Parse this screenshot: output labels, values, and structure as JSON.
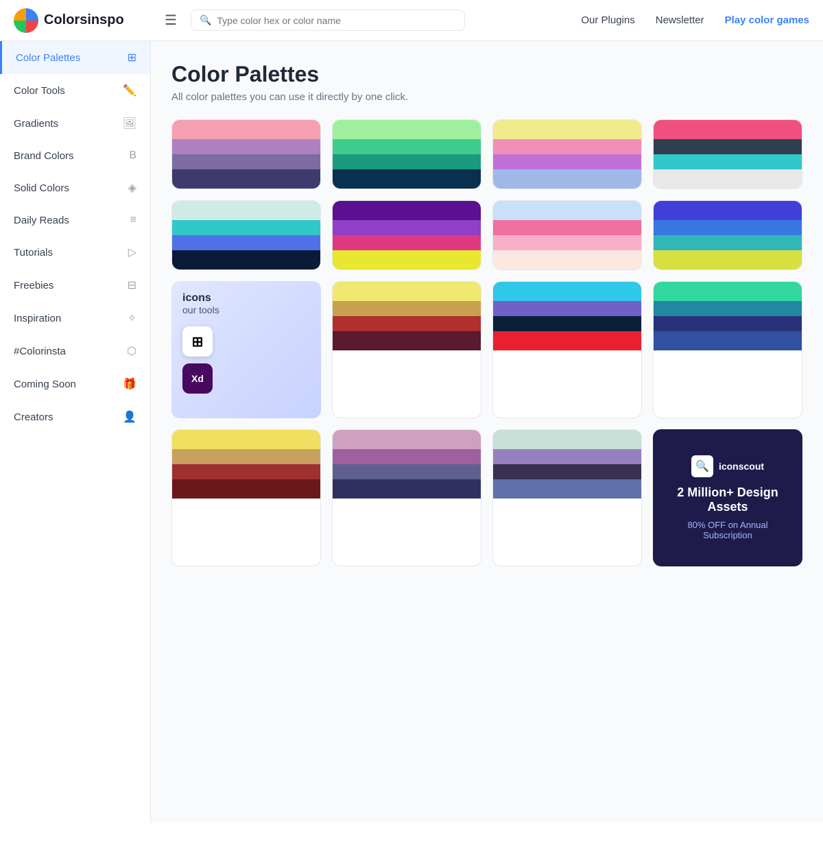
{
  "header": {
    "logo_text": "Colorsinspo",
    "search_placeholder": "Type color hex or color name",
    "nav_plugins": "Our Plugins",
    "nav_newsletter": "Newsletter",
    "nav_play": "Play color games"
  },
  "sidebar": {
    "items": [
      {
        "id": "color-palettes",
        "label": "Color Palettes",
        "icon": "⊞",
        "active": true
      },
      {
        "id": "color-tools",
        "label": "Color Tools",
        "icon": "✏️",
        "active": false
      },
      {
        "id": "gradients",
        "label": "Gradients",
        "icon": "🖼",
        "active": false
      },
      {
        "id": "brand-colors",
        "label": "Brand Colors",
        "icon": "B",
        "active": false
      },
      {
        "id": "solid-colors",
        "label": "Solid Colors",
        "icon": "◈",
        "active": false
      },
      {
        "id": "daily-reads",
        "label": "Daily Reads",
        "icon": "≡",
        "active": false
      },
      {
        "id": "tutorials",
        "label": "Tutorials",
        "icon": "▷",
        "active": false
      },
      {
        "id": "freebies",
        "label": "Freebies",
        "icon": "⊟",
        "active": false
      },
      {
        "id": "inspiration",
        "label": "Inspiration",
        "icon": "✧",
        "active": false
      },
      {
        "id": "colorinsta",
        "label": "#Colorinsta",
        "icon": "⬡",
        "active": false
      },
      {
        "id": "coming-soon",
        "label": "Coming Soon",
        "icon": "🎁",
        "active": false
      },
      {
        "id": "creators",
        "label": "Creators",
        "icon": "👤",
        "active": false
      }
    ]
  },
  "main": {
    "title": "Color Palettes",
    "subtitle": "All color palettes you can use it directly by one click.",
    "palettes": [
      {
        "id": 1,
        "colors": [
          "#f4a0b0",
          "#b07fc0",
          "#7c6ca0",
          "#3d3b6e"
        ]
      },
      {
        "id": 2,
        "colors": [
          "#9ef09e",
          "#3dcc8e",
          "#1a9a7e",
          "#0a3050"
        ]
      },
      {
        "id": 3,
        "colors": [
          "#f0ec8c",
          "#f090b8",
          "#c070d8",
          "#a0b8e8"
        ]
      },
      {
        "id": 4,
        "colors": [
          "#f05080",
          "#2e3f50",
          "#30c8c8",
          "#e8e8e8"
        ]
      },
      {
        "id": 5,
        "colors": [
          "#d0eae8",
          "#30c8c8",
          "#5070e8",
          "#0a1a38"
        ]
      },
      {
        "id": 6,
        "colors": [
          "#5a1090",
          "#9040c8",
          "#e03880",
          "#e8e830"
        ]
      },
      {
        "id": 7,
        "colors": [
          "#c8e0f8",
          "#f070a0",
          "#f8b0c8",
          "#fce8e0"
        ]
      },
      {
        "id": 8,
        "colors": [
          "#4040d8",
          "#3878e0",
          "#30b8b8",
          "#d8e040"
        ]
      },
      {
        "id": 9,
        "colors": [
          "#f0e870",
          "#c8a050",
          "#b03030",
          "#5a1a30"
        ]
      },
      {
        "id": 10,
        "colors": [
          "#30c8e8",
          "#7060c8",
          "#0a2038",
          "#e82030"
        ]
      },
      {
        "id": 11,
        "colors": [
          "#30d8a0",
          "#2088a0",
          "#2a3078",
          "#3050a0"
        ]
      },
      {
        "id": 12,
        "plugin": true,
        "title": "icons",
        "subtitle": "our tools",
        "ms_icon": "⊞",
        "xd_icon": "Xd"
      },
      {
        "id": 13,
        "colors": [
          "#f0e060",
          "#c8a060",
          "#a03030",
          "#6a1818"
        ]
      },
      {
        "id": 14,
        "colors": [
          "#d0a0c0",
          "#a060a0",
          "#606090",
          "#303060"
        ]
      },
      {
        "id": 15,
        "ad": true,
        "logo_text": "iconscout",
        "title": "2 Million+ Design Assets",
        "subtitle": "80% OFF on Annual Subscription"
      }
    ]
  }
}
